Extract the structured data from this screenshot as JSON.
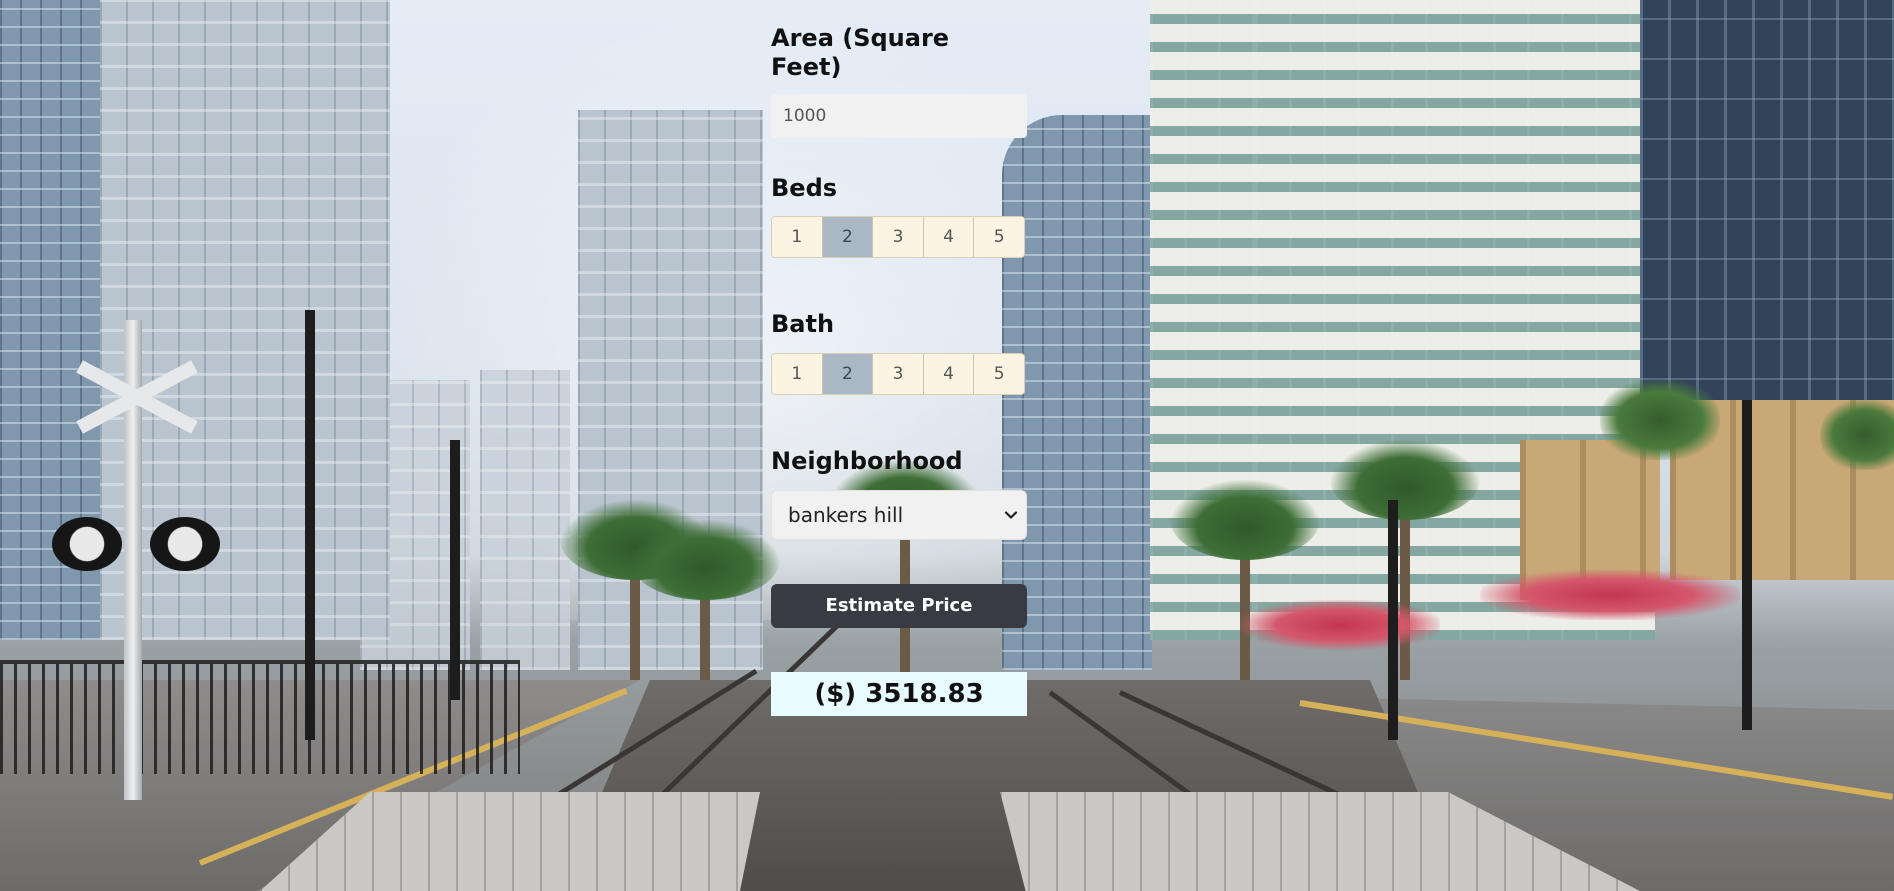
{
  "form": {
    "area": {
      "label": "Area (Square Feet)",
      "value": "1000"
    },
    "beds": {
      "label": "Beds",
      "options": [
        "1",
        "2",
        "3",
        "4",
        "5"
      ],
      "selected": "2"
    },
    "bath": {
      "label": "Bath",
      "options": [
        "1",
        "2",
        "3",
        "4",
        "5"
      ],
      "selected": "2"
    },
    "neighborhood": {
      "label": "Neighborhood",
      "selected": "bankers hill"
    },
    "estimate_button": "Estimate Price",
    "result": "($) 3518.83"
  },
  "icons": {
    "select_arrow": "chevron-down-icon"
  },
  "colors": {
    "segment_background": "#fbf4e3",
    "segment_active": "#a9b8c4",
    "button_background": "#383c42",
    "result_background": "#e8fbff",
    "input_background": "#f1f1f1"
  }
}
